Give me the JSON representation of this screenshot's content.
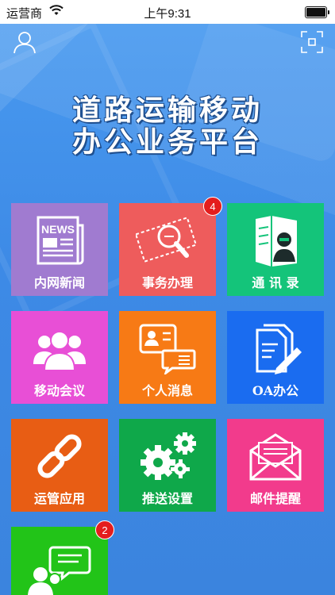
{
  "status_bar": {
    "carrier": "运营商",
    "time": "上午9:31"
  },
  "header": {
    "title_line1": "道路运输移动",
    "title_line2": "办公业务平台"
  },
  "tiles": [
    {
      "label": "内网新闻",
      "icon": "news-icon",
      "color": "#a07bd0"
    },
    {
      "label": "事务办理",
      "icon": "stamp-search-icon",
      "color": "#ee5c5c",
      "badge": "4"
    },
    {
      "label": "通 讯 录",
      "icon": "contacts-book-icon",
      "color": "#14c47a"
    },
    {
      "label": "移动会议",
      "icon": "meeting-people-icon",
      "color": "#e84fd6"
    },
    {
      "label": "个人消息",
      "icon": "personal-message-icon",
      "color": "#f77a15"
    },
    {
      "label": "OA办公",
      "icon": "document-edit-icon",
      "color": "#1a6cf0"
    },
    {
      "label": "运管应用",
      "icon": "chain-link-icon",
      "color": "#e85d14"
    },
    {
      "label": "推送设置",
      "icon": "gears-icon",
      "color": "#0fa84a"
    },
    {
      "label": "邮件提醒",
      "icon": "mail-icon",
      "color": "#f23b8c"
    },
    {
      "label": "",
      "icon": "chat-people-icon",
      "color": "#22c418",
      "badge": "2"
    }
  ]
}
